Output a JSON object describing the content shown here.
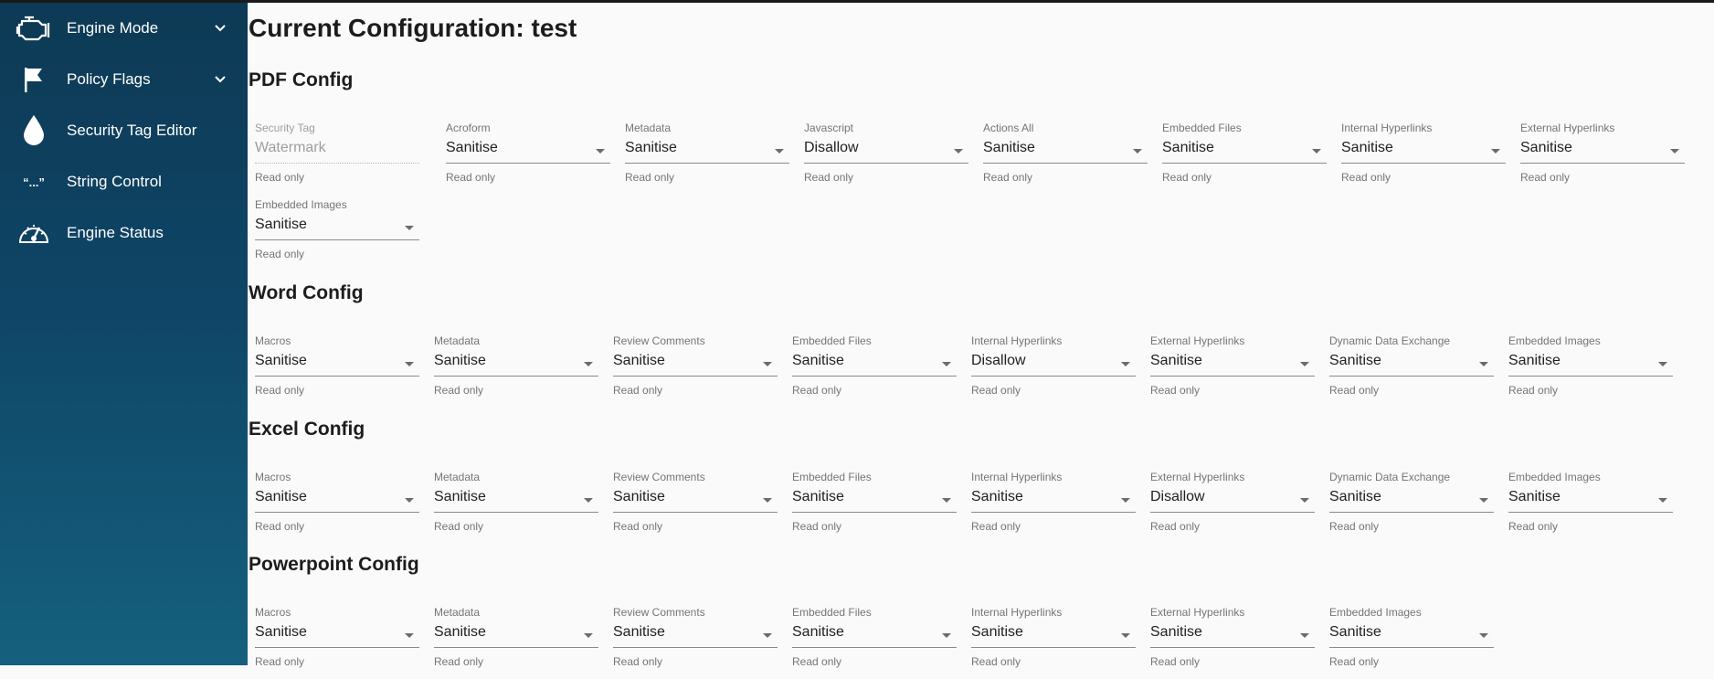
{
  "nav": [
    {
      "label": "Engine Mode",
      "icon": "engine-icon",
      "has_chevron": true
    },
    {
      "label": "Policy Flags",
      "icon": "flag-icon",
      "has_chevron": true
    },
    {
      "label": "Security Tag Editor",
      "icon": "droplet-icon",
      "has_chevron": false
    },
    {
      "label": "String Control",
      "icon": "quote-icon",
      "has_chevron": false
    },
    {
      "label": "Engine Status",
      "icon": "gauge-icon",
      "has_chevron": false
    }
  ],
  "quote_glyph": "“...”",
  "page_title": "Current Configuration: test",
  "helper_text": "Read only",
  "sections": [
    {
      "title": "PDF Config",
      "fields": [
        {
          "label": "Security Tag",
          "value": "Watermark",
          "type": "text",
          "disabled": true
        },
        {
          "label": "Acroform",
          "value": "Sanitise"
        },
        {
          "label": "Metadata",
          "value": "Sanitise"
        },
        {
          "label": "Javascript",
          "value": "Disallow"
        },
        {
          "label": "Actions All",
          "value": "Sanitise"
        },
        {
          "label": "Embedded Files",
          "value": "Sanitise"
        },
        {
          "label": "Internal Hyperlinks",
          "value": "Sanitise"
        },
        {
          "label": "External Hyperlinks",
          "value": "Sanitise"
        },
        {
          "label": "Embedded Images",
          "value": "Sanitise"
        }
      ]
    },
    {
      "title": "Word Config",
      "fields": [
        {
          "label": "Macros",
          "value": "Sanitise"
        },
        {
          "label": "Metadata",
          "value": "Sanitise"
        },
        {
          "label": "Review Comments",
          "value": "Sanitise"
        },
        {
          "label": "Embedded Files",
          "value": "Sanitise"
        },
        {
          "label": "Internal Hyperlinks",
          "value": "Disallow"
        },
        {
          "label": "External Hyperlinks",
          "value": "Sanitise"
        },
        {
          "label": "Dynamic Data Exchange",
          "value": "Sanitise"
        },
        {
          "label": "Embedded Images",
          "value": "Sanitise"
        }
      ]
    },
    {
      "title": "Excel Config",
      "fields": [
        {
          "label": "Macros",
          "value": "Sanitise"
        },
        {
          "label": "Metadata",
          "value": "Sanitise"
        },
        {
          "label": "Review Comments",
          "value": "Sanitise"
        },
        {
          "label": "Embedded Files",
          "value": "Sanitise"
        },
        {
          "label": "Internal Hyperlinks",
          "value": "Sanitise"
        },
        {
          "label": "External Hyperlinks",
          "value": "Disallow"
        },
        {
          "label": "Dynamic Data Exchange",
          "value": "Sanitise"
        },
        {
          "label": "Embedded Images",
          "value": "Sanitise"
        }
      ]
    },
    {
      "title": "Powerpoint Config",
      "fields": [
        {
          "label": "Macros",
          "value": "Sanitise"
        },
        {
          "label": "Metadata",
          "value": "Sanitise"
        },
        {
          "label": "Review Comments",
          "value": "Sanitise"
        },
        {
          "label": "Embedded Files",
          "value": "Sanitise"
        },
        {
          "label": "Internal Hyperlinks",
          "value": "Sanitise"
        },
        {
          "label": "External Hyperlinks",
          "value": "Sanitise"
        },
        {
          "label": "Embedded Images",
          "value": "Sanitise"
        }
      ]
    }
  ]
}
